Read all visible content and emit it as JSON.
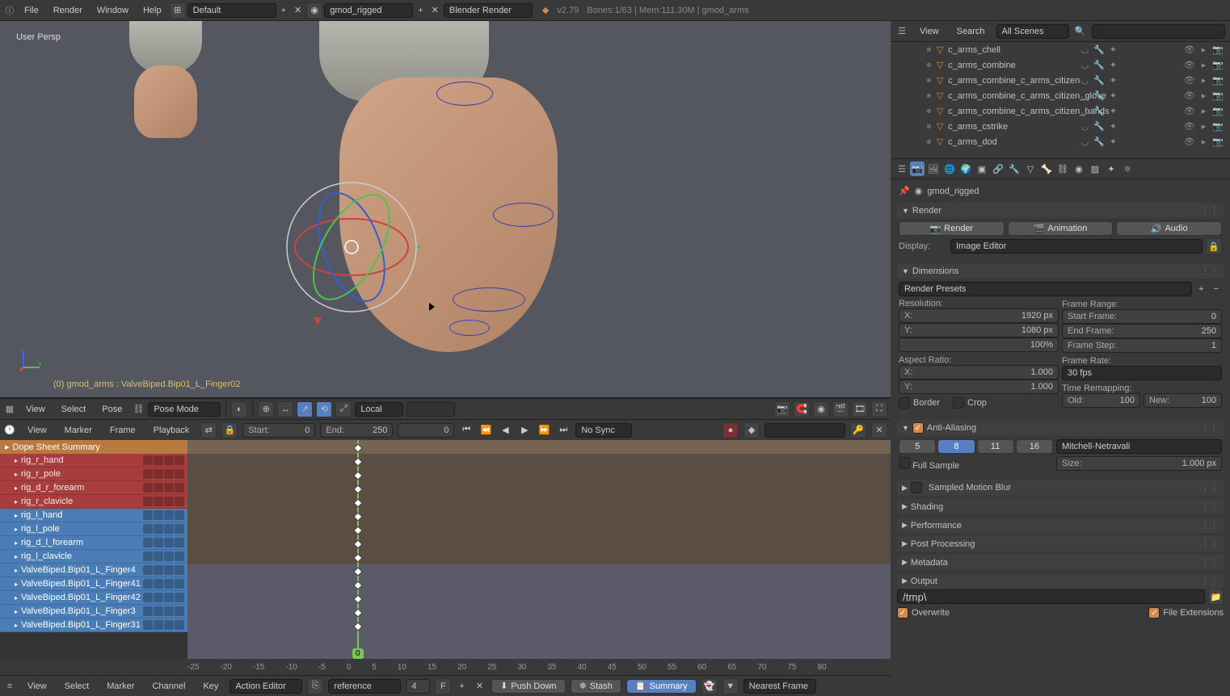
{
  "top": {
    "menus": [
      "File",
      "Render",
      "Window",
      "Help"
    ],
    "scene_layout": "Default",
    "scene_name": "gmod_rigged",
    "engine": "Blender Render",
    "version": "v2.79",
    "stats": "Bones:1/63 | Mem:111.30M | gmod_arms"
  },
  "viewport": {
    "persp": "User Persp",
    "bottom_label": "(0) gmod_arms : ValveBiped.Bip01_L_Finger02",
    "menus": [
      "View",
      "Select",
      "Pose"
    ],
    "mode": "Pose Mode",
    "orientation": "Local"
  },
  "timeline": {
    "menus": [
      "View",
      "Marker",
      "Frame",
      "Playback"
    ],
    "start_label": "Start:",
    "start": "0",
    "end_label": "End:",
    "end": "250",
    "current": "0",
    "sync": "No Sync"
  },
  "dopesheet": {
    "summary": "Dope Sheet Summary",
    "channels_red": [
      "rig_r_hand",
      "rig_r_pole",
      "rig_d_r_forearm",
      "rig_r_clavicle"
    ],
    "channels_blue": [
      "rig_l_hand",
      "rig_l_pole",
      "rig_d_l_forearm",
      "rig_l_clavicle",
      "ValveBiped.Bip01_L_Finger4",
      "ValveBiped.Bip01_L_Finger41",
      "ValveBiped.Bip01_L_Finger42",
      "ValveBiped.Bip01_L_Finger3",
      "ValveBiped.Bip01_L_Finger31"
    ],
    "ruler": [
      "-25",
      "-20",
      "-15",
      "-10",
      "-5",
      "0",
      "5",
      "10",
      "15",
      "20",
      "25",
      "30",
      "35",
      "40",
      "45",
      "50",
      "55",
      "60",
      "65",
      "70",
      "75",
      "80"
    ],
    "frame_badge": "0"
  },
  "action": {
    "menus": [
      "View",
      "Select",
      "Marker",
      "Channel",
      "Key"
    ],
    "editor": "Action Editor",
    "action_name": "reference",
    "fake_users": "4",
    "push": "Push Down",
    "stash": "Stash",
    "summary": "Summary",
    "nearest": "Nearest Frame"
  },
  "outliner": {
    "menus": [
      "View",
      "Search"
    ],
    "filter": "All Scenes",
    "items": [
      "c_arms_chell",
      "c_arms_combine",
      "c_arms_combine_c_arms_citizen",
      "c_arms_combine_c_arms_citizen_glove",
      "c_arms_combine_c_arms_citizen_hands",
      "c_arms_cstrike",
      "c_arms_dod"
    ]
  },
  "props": {
    "breadcrumb": "gmod_rigged",
    "render": {
      "title": "Render",
      "render_btn": "Render",
      "anim_btn": "Animation",
      "audio_btn": "Audio",
      "display_label": "Display:",
      "display_value": "Image Editor"
    },
    "dimensions": {
      "title": "Dimensions",
      "presets": "Render Presets",
      "resolution_label": "Resolution:",
      "x": "1920 px",
      "y": "1080 px",
      "percent": "100%",
      "aspect_label": "Aspect Ratio:",
      "ax": "1.000",
      "ay": "1.000",
      "border": "Border",
      "crop": "Crop",
      "frame_range": "Frame Range:",
      "start_frame": "0",
      "end_frame": "250",
      "frame_step": "1",
      "frame_rate_label": "Frame Rate:",
      "fps": "30 fps",
      "remap": "Time Remapping:",
      "old": "100",
      "new": "100"
    },
    "aa": {
      "title": "Anti-Aliasing",
      "samples": [
        "5",
        "8",
        "11",
        "16"
      ],
      "active_sample": 1,
      "filter": "Mitchell-Netravali",
      "full_sample": "Full Sample",
      "size_label": "Size:",
      "size": "1.000 px"
    },
    "collapsed": [
      "Sampled Motion Blur",
      "Shading",
      "Performance",
      "Post Processing",
      "Metadata",
      "Output"
    ],
    "output_path": "/tmp\\",
    "overwrite": "Overwrite",
    "file_ext": "File Extensions"
  }
}
